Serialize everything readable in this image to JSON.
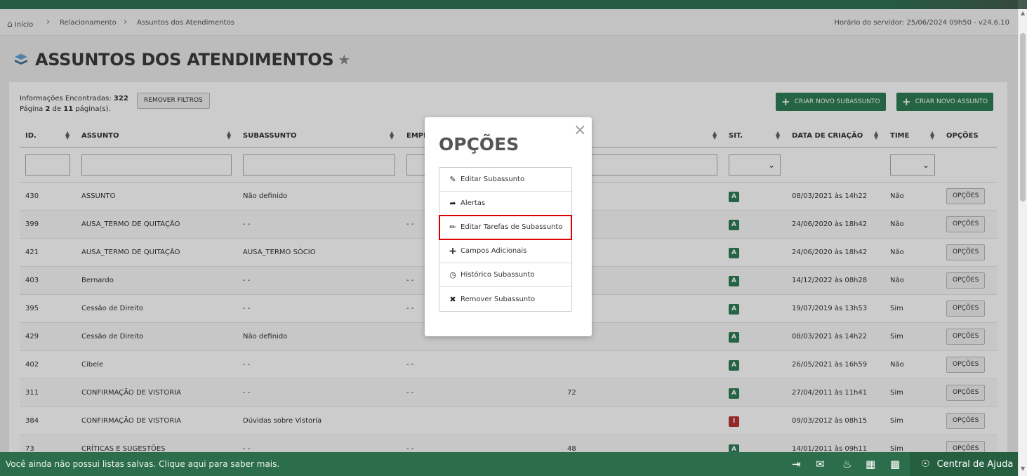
{
  "breadcrumb": {
    "home": "Início",
    "level1": "Relacionamento",
    "level2": "Assuntos dos Atendimentos"
  },
  "server_time": "Horário do servidor: 25/06/2024 09h50 - v24.6.10",
  "page_title": "ASSUNTOS DOS ATENDIMENTOS",
  "info": {
    "found_label": "Informações Encontradas:",
    "found_value": "322",
    "page_label": "Página",
    "page_current": "2",
    "page_of": "de",
    "page_total": "11",
    "page_suffix": "página(s)."
  },
  "buttons": {
    "remove_filters": "REMOVER FILTROS",
    "new_subject_child": "CRIAR NOVO SUBASSUNTO",
    "new_subject": "CRIAR NOVO ASSUNTO",
    "row_options": "OPÇÕES"
  },
  "columns": {
    "id": "ID.",
    "assunto": "ASSUNTO",
    "subassunto": "SUBASSUNTO",
    "empresa": "EMPR",
    "sit": "SIT.",
    "data": "DATA DE CRIAÇÃO",
    "time": "TIME",
    "opcoes": "OPÇÕES"
  },
  "rows": [
    {
      "id": "430",
      "assunto": "ASSUNTO",
      "subassunto": "Não definido",
      "empresa": "",
      "col5": "",
      "sit": "A",
      "data": "08/03/2021 às 14h22",
      "time": "Não"
    },
    {
      "id": "399",
      "assunto": "AUSA_TERMO DE QUITAÇÃO",
      "subassunto": "- -",
      "empresa": "- -",
      "col5": "",
      "sit": "A",
      "data": "24/06/2020 às 18h42",
      "time": "Não"
    },
    {
      "id": "421",
      "assunto": "AUSA_TERMO DE QUITAÇÃO",
      "subassunto": "AUSA_TERMO SÓCIO",
      "empresa": "",
      "col5": "",
      "sit": "A",
      "data": "24/06/2020 às 18h42",
      "time": "Não"
    },
    {
      "id": "403",
      "assunto": "Bernardo",
      "subassunto": "- -",
      "empresa": "- -",
      "col5": "",
      "sit": "A",
      "data": "14/12/2022 às 08h28",
      "time": "Não"
    },
    {
      "id": "395",
      "assunto": "Cessão de Direito",
      "subassunto": "- -",
      "empresa": "- -",
      "col5": "",
      "sit": "A",
      "data": "19/07/2019 às 13h53",
      "time": "Sim"
    },
    {
      "id": "429",
      "assunto": "Cessão de Direito",
      "subassunto": "Não definido",
      "empresa": "",
      "col5": "",
      "sit": "A",
      "data": "08/03/2021 às 14h22",
      "time": "Sim"
    },
    {
      "id": "402",
      "assunto": "Cibele",
      "subassunto": "- -",
      "empresa": "- -",
      "col5": "",
      "sit": "A",
      "data": "26/05/2021 às 16h59",
      "time": "Não"
    },
    {
      "id": "311",
      "assunto": "CONFIRMAÇÃO DE VISTORIA",
      "subassunto": "- -",
      "empresa": "- -",
      "col5": "72",
      "sit": "A",
      "data": "27/04/2011 às 11h41",
      "time": "Sim"
    },
    {
      "id": "384",
      "assunto": "CONFIRMAÇÃO DE VISTORIA",
      "subassunto": "Dúvidas sobre Vistoria",
      "empresa": "",
      "col5": "",
      "sit": "I",
      "data": "09/03/2012 às 08h15",
      "time": "Sim"
    },
    {
      "id": "73",
      "assunto": "CRÍTICAS E SUGESTÕES",
      "subassunto": "- -",
      "empresa": "- -",
      "col5": "48",
      "sit": "A",
      "data": "14/01/2011 às 09h11",
      "time": "Sim"
    }
  ],
  "status_colors": {
    "A": "#2e7d55",
    "I": "#b93232"
  },
  "modal": {
    "title": "OPÇÕES",
    "close": "×",
    "items": [
      {
        "label": "Editar Subassunto",
        "icon": "edit-icon"
      },
      {
        "label": "Alertas",
        "icon": "share-arrow-icon"
      },
      {
        "label": "Editar Tarefas de Subassunto",
        "icon": "pencil-icon"
      },
      {
        "label": "Campos Adicionais",
        "icon": "plus-icon"
      },
      {
        "label": "Histórico Subassunto",
        "icon": "clock-icon"
      },
      {
        "label": "Remover Subassunto",
        "icon": "times-icon"
      }
    ]
  },
  "footer": {
    "message": "Você ainda não possui listas salvas. Clique aqui para saber mais.",
    "help": "Central de Ajuda"
  }
}
